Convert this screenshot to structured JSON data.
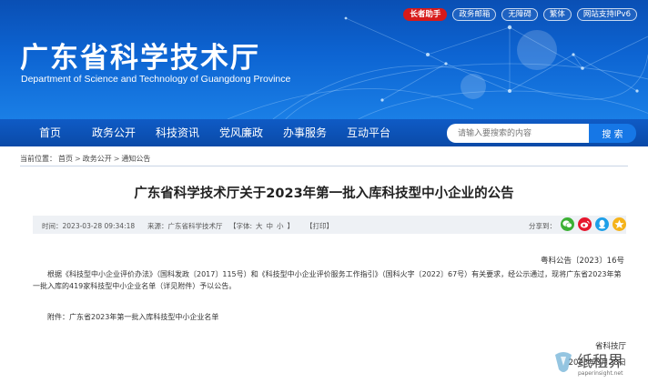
{
  "header": {
    "site_title": "广东省科学技术厅",
    "site_subtitle": "Department of Science and Technology of Guangdong Province",
    "top_links": [
      "长者助手",
      "政务邮箱",
      "无障碍",
      "繁体",
      "网站支持IPv6"
    ]
  },
  "nav": {
    "items": [
      "首页",
      "政务公开",
      "科技资讯",
      "党风廉政",
      "办事服务",
      "互动平台"
    ],
    "search_placeholder": "请输入要搜索的内容",
    "search_button": "搜 索"
  },
  "breadcrumb": {
    "prefix": "当前位置：",
    "items": [
      "首页",
      "政务公开",
      "通知公告"
    ],
    "separator": ">"
  },
  "article": {
    "title": "广东省科学技术厅关于2023年第一批入库科技型中小企业的公告",
    "meta": {
      "time": "时间：2023-03-28 09:34:18",
      "source": "来源：广东省科学技术厅",
      "font_prefix": "【字体:",
      "font_sizes": [
        "大",
        "中",
        "小"
      ],
      "font_suffix": "】",
      "print": "【打印】",
      "share_label": "分享到："
    },
    "doc_number": "粤科公告〔2023〕16号",
    "paragraph1": "根据《科技型中小企业评价办法》（国科发政〔2017〕115号）和《科技型中小企业评价服务工作指引》（国科火字〔2022〕67号）有关要求，经公示通过，现将广东省2023年第一批入库的419家科技型中小企业名单（详见附件）予以公告。",
    "attachment": "附件：广东省2023年第一批入库科技型中小企业名单",
    "signature_org": "省科技厅",
    "signature_date": "2023年3月28日"
  },
  "share_icons": [
    "wechat-icon",
    "weibo-icon",
    "qq-icon",
    "qzone-icon"
  ],
  "colors": {
    "primary": "#0d64d2",
    "nav": "#0a4aa8",
    "elder_badge": "#d71a1a",
    "wechat": "#3cb034",
    "weibo": "#e6162d",
    "qq": "#1e9fe8",
    "qzone": "#f5b31a"
  },
  "watermark": {
    "text": "纸租界",
    "url": "paperinsight.net"
  }
}
